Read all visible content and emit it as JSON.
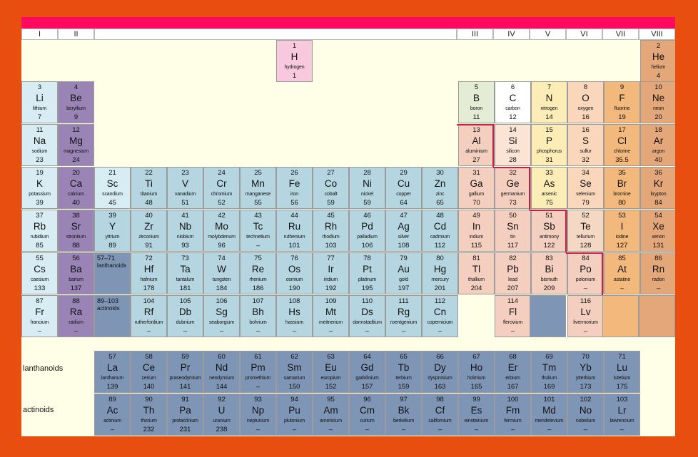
{
  "group_headers": [
    "I",
    "II",
    "III",
    "IV",
    "V",
    "VI",
    "VII",
    "VIII"
  ],
  "row_labels": {
    "lanthanoids": "lanthanoids",
    "actinoids": "actinoids"
  },
  "ref_boxes": {
    "lanthanoids": {
      "num": "57–71",
      "label": "lanthanoids"
    },
    "actinoids": {
      "num": "89–103",
      "label": "actinoids"
    }
  },
  "colors": {
    "background": "#e84e0f",
    "top_bar": "#ff0a5e",
    "panel": "#ffffe8",
    "alkali": "#d7edf3",
    "alkaline_earth": "#9a84b6",
    "transition": "#b5d5e0",
    "lanthanoid_actinoid": "#7e95b6",
    "hydrogen": "#f8c8dc",
    "metal": "#f4cfc0",
    "halogen": "#f3b97c",
    "noble_gas": "#e3a77a",
    "boundary_line": "#c92040"
  },
  "elements": [
    [
      "1",
      "H",
      "hydrogen",
      "1"
    ],
    [
      "2",
      "He",
      "helium",
      "4"
    ],
    [
      "3",
      "Li",
      "lithium",
      "7"
    ],
    [
      "4",
      "Be",
      "beryllium",
      "9"
    ],
    [
      "5",
      "B",
      "boron",
      "11"
    ],
    [
      "6",
      "C",
      "carbon",
      "12"
    ],
    [
      "7",
      "N",
      "nitrogen",
      "14"
    ],
    [
      "8",
      "O",
      "oxygen",
      "16"
    ],
    [
      "9",
      "F",
      "fluorine",
      "19"
    ],
    [
      "10",
      "Ne",
      "neon",
      "20"
    ],
    [
      "11",
      "Na",
      "sodium",
      "23"
    ],
    [
      "12",
      "Mg",
      "magnesium",
      "24"
    ],
    [
      "13",
      "Al",
      "aluminium",
      "27"
    ],
    [
      "14",
      "Si",
      "silicon",
      "28"
    ],
    [
      "15",
      "P",
      "phosphorus",
      "31"
    ],
    [
      "16",
      "S",
      "sulfur",
      "32"
    ],
    [
      "17",
      "Cl",
      "chlorine",
      "35.5"
    ],
    [
      "18",
      "Ar",
      "argon",
      "40"
    ],
    [
      "19",
      "K",
      "potassium",
      "39"
    ],
    [
      "20",
      "Ca",
      "calcium",
      "40"
    ],
    [
      "21",
      "Sc",
      "scandium",
      "45"
    ],
    [
      "22",
      "Ti",
      "titanium",
      "48"
    ],
    [
      "23",
      "V",
      "vanadium",
      "51"
    ],
    [
      "24",
      "Cr",
      "chromium",
      "52"
    ],
    [
      "25",
      "Mn",
      "manganese",
      "55"
    ],
    [
      "26",
      "Fe",
      "iron",
      "56"
    ],
    [
      "27",
      "Co",
      "cobalt",
      "59"
    ],
    [
      "28",
      "Ni",
      "nickel",
      "59"
    ],
    [
      "29",
      "Cu",
      "copper",
      "64"
    ],
    [
      "30",
      "Zn",
      "zinc",
      "65"
    ],
    [
      "31",
      "Ga",
      "gallium",
      "70"
    ],
    [
      "32",
      "Ge",
      "germanium",
      "73"
    ],
    [
      "33",
      "As",
      "arsenic",
      "75"
    ],
    [
      "34",
      "Se",
      "selenium",
      "79"
    ],
    [
      "35",
      "Br",
      "bromine",
      "80"
    ],
    [
      "36",
      "Kr",
      "krypton",
      "84"
    ],
    [
      "37",
      "Rb",
      "rubidium",
      "85"
    ],
    [
      "38",
      "Sr",
      "strontium",
      "88"
    ],
    [
      "39",
      "Y",
      "yttrium",
      "89"
    ],
    [
      "40",
      "Zr",
      "zirconium",
      "91"
    ],
    [
      "41",
      "Nb",
      "niobium",
      "93"
    ],
    [
      "42",
      "Mo",
      "molybdenum",
      "96"
    ],
    [
      "43",
      "Tc",
      "technetium",
      "–"
    ],
    [
      "44",
      "Ru",
      "ruthenium",
      "101"
    ],
    [
      "45",
      "Rh",
      "rhodium",
      "103"
    ],
    [
      "46",
      "Pd",
      "palladium",
      "106"
    ],
    [
      "47",
      "Ag",
      "silver",
      "108"
    ],
    [
      "48",
      "Cd",
      "cadmium",
      "112"
    ],
    [
      "49",
      "In",
      "indium",
      "115"
    ],
    [
      "50",
      "Sn",
      "tin",
      "117"
    ],
    [
      "51",
      "Sb",
      "antimony",
      "122"
    ],
    [
      "52",
      "Te",
      "tellurium",
      "128"
    ],
    [
      "53",
      "I",
      "iodine",
      "127"
    ],
    [
      "54",
      "Xe",
      "xenon",
      "131"
    ],
    [
      "55",
      "Cs",
      "caesium",
      "133"
    ],
    [
      "56",
      "Ba",
      "barium",
      "137"
    ],
    [
      "72",
      "Hf",
      "hafnium",
      "178"
    ],
    [
      "73",
      "Ta",
      "tantalum",
      "181"
    ],
    [
      "74",
      "W",
      "tungsten",
      "184"
    ],
    [
      "75",
      "Re",
      "rhenium",
      "186"
    ],
    [
      "76",
      "Os",
      "osmium",
      "190"
    ],
    [
      "77",
      "Ir",
      "iridium",
      "192"
    ],
    [
      "78",
      "Pt",
      "platinum",
      "195"
    ],
    [
      "79",
      "Au",
      "gold",
      "197"
    ],
    [
      "80",
      "Hg",
      "mercury",
      "201"
    ],
    [
      "81",
      "Tl",
      "thallium",
      "204"
    ],
    [
      "82",
      "Pb",
      "lead",
      "207"
    ],
    [
      "83",
      "Bi",
      "bismuth",
      "209"
    ],
    [
      "84",
      "Po",
      "polonium",
      "–"
    ],
    [
      "85",
      "At",
      "astatine",
      "–"
    ],
    [
      "86",
      "Rn",
      "radon",
      "–"
    ],
    [
      "87",
      "Fr",
      "francium",
      "–"
    ],
    [
      "88",
      "Ra",
      "radium",
      "–"
    ],
    [
      "104",
      "Rf",
      "rutherfordium",
      "–"
    ],
    [
      "105",
      "Db",
      "dubnium",
      "–"
    ],
    [
      "106",
      "Sg",
      "seaborgium",
      "–"
    ],
    [
      "107",
      "Bh",
      "bohrium",
      "–"
    ],
    [
      "108",
      "Hs",
      "hassium",
      "–"
    ],
    [
      "109",
      "Mt",
      "meitnerium",
      "–"
    ],
    [
      "110",
      "Ds",
      "darmstadtium",
      "–"
    ],
    [
      "111",
      "Rg",
      "roentgenium",
      "–"
    ],
    [
      "112",
      "Cn",
      "copernicium",
      "–"
    ],
    [
      "114",
      "Fl",
      "flerovium",
      "–"
    ],
    [
      "116",
      "Lv",
      "livermorium",
      "–"
    ],
    [
      "57",
      "La",
      "lanthanum",
      "139"
    ],
    [
      "58",
      "Ce",
      "cerium",
      "140"
    ],
    [
      "59",
      "Pr",
      "praseodymium",
      "141"
    ],
    [
      "60",
      "Nd",
      "neodymium",
      "144"
    ],
    [
      "61",
      "Pm",
      "promethium",
      "–"
    ],
    [
      "62",
      "Sm",
      "samarium",
      "150"
    ],
    [
      "63",
      "Eu",
      "europium",
      "152"
    ],
    [
      "64",
      "Gd",
      "gadolinium",
      "157"
    ],
    [
      "65",
      "Tb",
      "terbium",
      "159"
    ],
    [
      "66",
      "Dy",
      "dysprosium",
      "163"
    ],
    [
      "67",
      "Ho",
      "holmium",
      "165"
    ],
    [
      "68",
      "Er",
      "erbium",
      "167"
    ],
    [
      "69",
      "Tm",
      "thulium",
      "169"
    ],
    [
      "70",
      "Yb",
      "ytterbium",
      "173"
    ],
    [
      "71",
      "Lu",
      "lutetium",
      "175"
    ],
    [
      "89",
      "Ac",
      "actinium",
      "–"
    ],
    [
      "90",
      "Th",
      "thorium",
      "232"
    ],
    [
      "91",
      "Pa",
      "protactinium",
      "231"
    ],
    [
      "92",
      "U",
      "uranium",
      "238"
    ],
    [
      "93",
      "Np",
      "neptunium",
      "–"
    ],
    [
      "94",
      "Pu",
      "plutonium",
      "–"
    ],
    [
      "95",
      "Am",
      "americium",
      "–"
    ],
    [
      "96",
      "Cm",
      "curium",
      "–"
    ],
    [
      "97",
      "Bk",
      "berkelium",
      "–"
    ],
    [
      "98",
      "Cf",
      "californium",
      "–"
    ],
    [
      "99",
      "Es",
      "einsteinium",
      "–"
    ],
    [
      "100",
      "Fm",
      "fermium",
      "–"
    ],
    [
      "101",
      "Md",
      "mendelevium",
      "–"
    ],
    [
      "102",
      "No",
      "nobelium",
      "–"
    ],
    [
      "103",
      "Lr",
      "lawrencium",
      "–"
    ]
  ]
}
